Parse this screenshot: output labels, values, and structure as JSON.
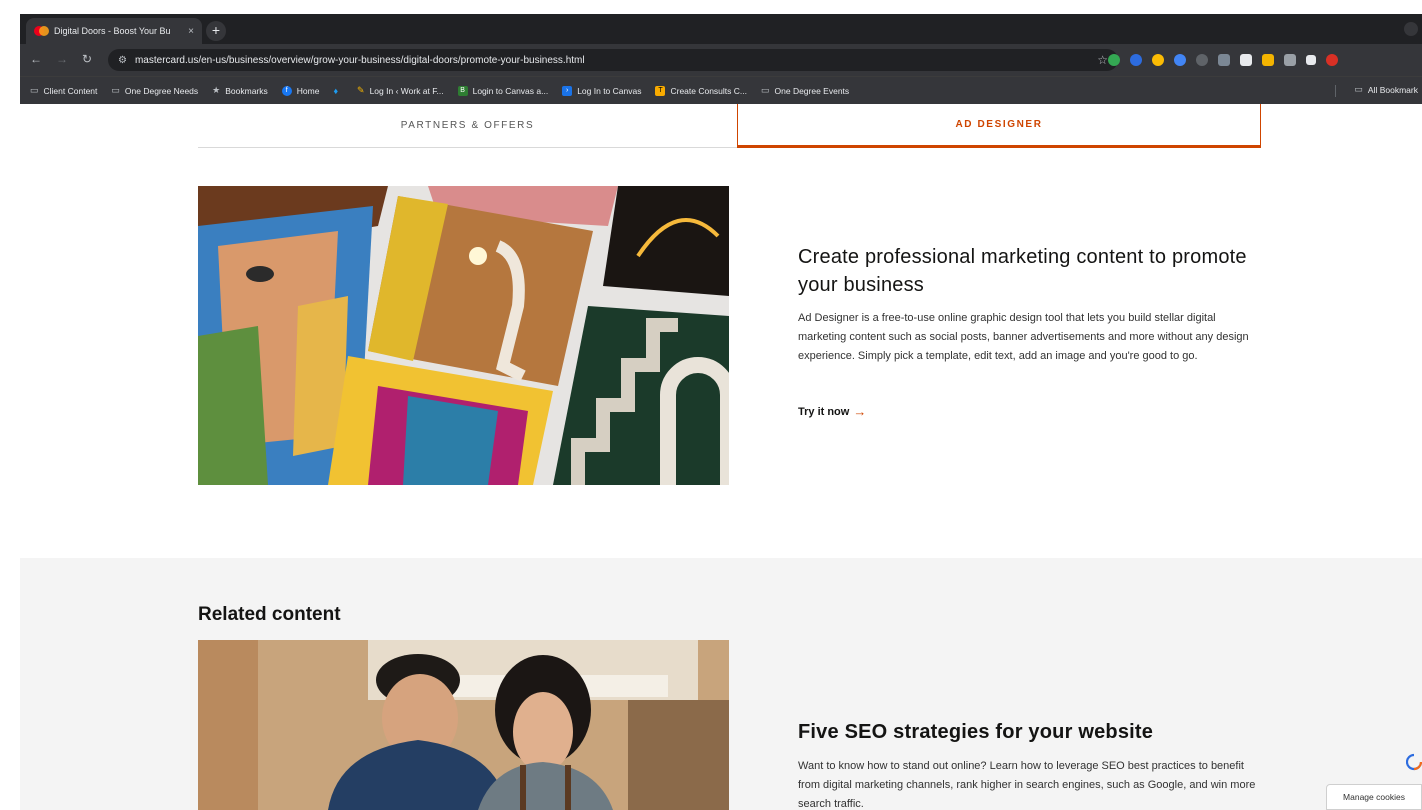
{
  "browser": {
    "tab_title": "Digital Doors - Boost Your Bu",
    "tab_close": "×",
    "new_tab": "+",
    "url": "mastercard.us/en-us/business/overview/grow-your-business/digital-doors/promote-your-business.html",
    "bookmarks": [
      {
        "label": "Client Content",
        "icon": "folder-icon"
      },
      {
        "label": "One Degree Needs",
        "icon": "folder-icon"
      },
      {
        "label": "Bookmarks",
        "icon": "star-icon"
      },
      {
        "label": "Home",
        "icon": "facebook-icon"
      },
      {
        "label": "",
        "icon": "twitter-icon"
      },
      {
        "label": "Log In ‹ Work at F...",
        "icon": "wordpress-icon"
      },
      {
        "label": "Login to Canvas a...",
        "icon": "canvas-icon"
      },
      {
        "label": "Log In to Canvas",
        "icon": "canvas-icon"
      },
      {
        "label": "Create Consults C...",
        "icon": "create-icon"
      },
      {
        "label": "One Degree Events",
        "icon": "folder-icon"
      }
    ],
    "all_bookmarks": "All Bookmark"
  },
  "subnav": {
    "partners": "PARTNERS & OFFERS",
    "ad_designer": "AD DESIGNER"
  },
  "hero": {
    "title": "Create professional marketing content to promote your business",
    "body": "Ad Designer is a free-to-use online graphic design tool that lets you build stellar digital marketing content such as social posts, banner advertisements and more without any design experience. Simply pick a template, edit text, add an image and you're good to go.",
    "cta": "Try it now",
    "cta_arrow": "→"
  },
  "related": {
    "heading": "Related content",
    "card_title": "Five SEO strategies for your website",
    "card_body": "Want to know how to stand out online? Learn how to leverage SEO best practices to benefit from digital marketing channels, rank higher in search engines, such as Google, and win more search traffic."
  },
  "cookies": {
    "label": "Manage cookies"
  },
  "colors": {
    "accent": "#cf4500",
    "related_bg": "#f4f4f4",
    "chrome_bg": "#35363a"
  }
}
